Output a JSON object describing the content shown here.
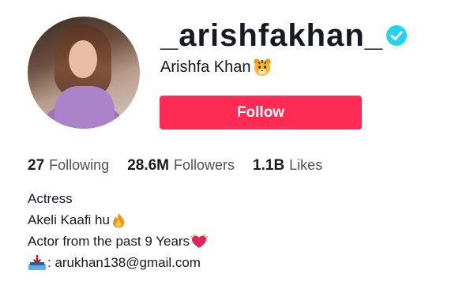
{
  "profile": {
    "username": "_arishfakhan_",
    "display_name": "Arishfa Khan",
    "name_emoji": "tiger-face-icon",
    "verified": true
  },
  "follow_button": {
    "label": "Follow"
  },
  "stats": {
    "following_count": "27",
    "following_label": "Following",
    "followers_count": "28.6M",
    "followers_label": "Followers",
    "likes_count": "1.1B",
    "likes_label": "Likes"
  },
  "bio": {
    "line1": "Actress",
    "line2": "Akeli Kaafi hu",
    "line2_emoji": "fire-icon",
    "line3": "Actor from the past 9 Years",
    "line3_emoji": "heart-on-fire-icon",
    "line4_prefix_icon": "inbox-tray-icon",
    "line4": ": arukhan138@gmail.com"
  },
  "colors": {
    "follow_button": "#fe2c55",
    "verified_badge": "#20d5ec",
    "primary_text": "#161823",
    "secondary_text": "#4f5059"
  }
}
